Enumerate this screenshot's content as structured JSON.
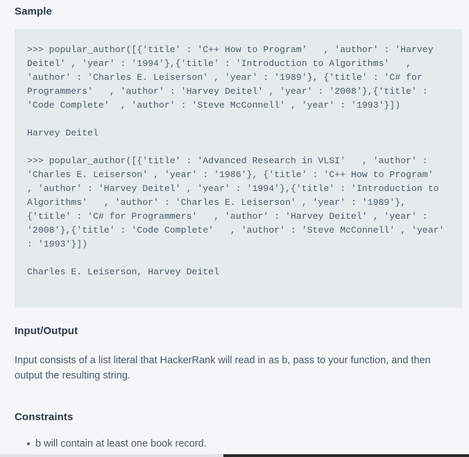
{
  "sections": {
    "sample": {
      "heading": "Sample",
      "code": {
        "call_one": ">>> popular_author([{'title' : 'C++ How to Program'   , 'author' : 'Harvey Deitel' , 'year' : '1994'},{'title' : 'Introduction to Algorithms'   , 'author' : 'Charles E. Leiserson' , 'year' : '1989'}, {'title' : 'C# for Programmers'   , 'author' : 'Harvey Deitel' , 'year' : '2008'},{'title' : 'Code Complete'  , 'author' : 'Steve McConnell' , 'year' : '1993'}])",
        "output_one": "Harvey Deitel",
        "call_two": ">>> popular_author([{'title' : 'Advanced Research in VLSI'   , 'author' : 'Charles E. Leiserson' , 'year' : '1986'}, {'title' : 'C++ How to Program'   , 'author' : 'Harvey Deitel' , 'year' : '1994'},{'title' : 'Introduction to Algorithms'   , 'author' : 'Charles E. Leiserson' , 'year' : '1989'},{'title' : 'C# for Programmers'   , 'author' : 'Harvey Deitel' , 'year' : '2008'},{'title' : 'Code Complete'   , 'author' : 'Steve McConnell' , 'year' : '1993'}])",
        "output_two": "Charles E. Leiserson, Harvey Deitel"
      }
    },
    "input_output": {
      "heading": "Input/Output",
      "paragraph": "Input consists of a list literal that HackerRank will read in as b, pass to your function, and then output the resulting string."
    },
    "constraints": {
      "heading": "Constraints",
      "items": [
        "b will contain at least one book record."
      ]
    }
  },
  "colors": {
    "page_background": "#f4f6f7",
    "code_background": "#e5ebed",
    "heading_text": "#2b3a48",
    "body_text": "#4a5864",
    "code_text": "#4b5a6a",
    "progress_track": "#dfe3e6",
    "progress_fill": "#2b2b2b"
  }
}
